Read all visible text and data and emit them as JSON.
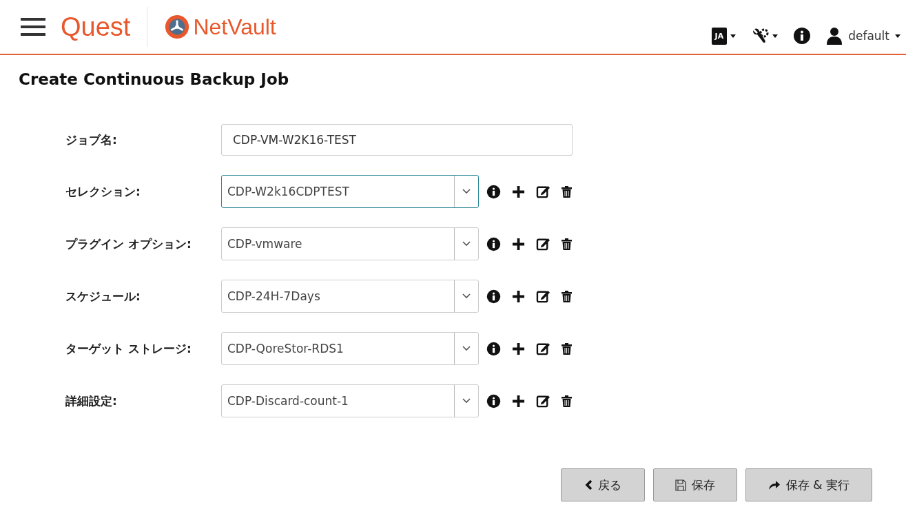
{
  "header": {
    "brand": "Quest",
    "product": "NetVault",
    "language": "JA",
    "user": "default"
  },
  "page": {
    "title": "Create Continuous Backup Job"
  },
  "form": {
    "job_name": {
      "label": "ジョブ名:",
      "value": "CDP-VM-W2K16-TEST"
    },
    "sets": [
      {
        "label": "セレクション:",
        "value": "CDP-W2k16CDPTEST",
        "focused": true
      },
      {
        "label": "プラグイン オプション:",
        "value": "CDP-vmware",
        "focused": false
      },
      {
        "label": "スケジュール:",
        "value": "CDP-24H-7Days",
        "focused": false
      },
      {
        "label": "ターゲット ストレージ:",
        "value": "CDP-QoreStor-RDS1",
        "focused": false
      },
      {
        "label": "詳細設定:",
        "value": "CDP-Discard-count-1",
        "focused": false
      }
    ]
  },
  "buttons": [
    {
      "kind": "back",
      "label": "戻る"
    },
    {
      "kind": "save",
      "label": "保存"
    },
    {
      "kind": "run",
      "label": "保存 & 実行"
    }
  ]
}
